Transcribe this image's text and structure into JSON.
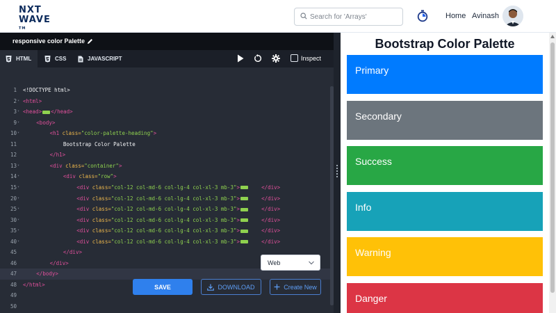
{
  "header": {
    "logo_line1": "NXT",
    "logo_line2": "WAVE",
    "logo_tm": "TM",
    "search_placeholder": "Search for 'Arrays'",
    "home_label": "Home",
    "user_name": "Avinash"
  },
  "project": {
    "title": "responsive color Palette"
  },
  "tabs": [
    {
      "label": "HTML",
      "active": true
    },
    {
      "label": "CSS",
      "active": false
    },
    {
      "label": "JAVASCRIPT",
      "active": false
    }
  ],
  "toolbar": {
    "inspect_label": "Inspect"
  },
  "editor": {
    "lines": [
      {
        "num": "1",
        "fold": false,
        "indent": 0,
        "parts": [
          [
            "tx",
            "<!DOCTYPE html>"
          ]
        ]
      },
      {
        "num": "2",
        "fold": true,
        "indent": 0,
        "parts": [
          [
            "tg",
            "<html>"
          ]
        ]
      },
      {
        "num": "3",
        "fold": true,
        "indent": 0,
        "parts": [
          [
            "tg",
            "<head>"
          ],
          [
            "pill",
            ""
          ],
          [
            "tg",
            "</head>"
          ]
        ]
      },
      {
        "num": "9",
        "fold": true,
        "indent": 1,
        "parts": [
          [
            "tg",
            "<body>"
          ]
        ]
      },
      {
        "num": "10",
        "fold": true,
        "indent": 2,
        "parts": [
          [
            "tg",
            "<h1 "
          ],
          [
            "at",
            "class="
          ],
          [
            "st",
            "\"color-palette-heading\""
          ],
          [
            "tg",
            ">"
          ]
        ]
      },
      {
        "num": "11",
        "fold": false,
        "indent": 3,
        "parts": [
          [
            "tx",
            "Bootstrap Color Palette"
          ]
        ]
      },
      {
        "num": "12",
        "fold": false,
        "indent": 2,
        "parts": [
          [
            "tg",
            "</h1>"
          ]
        ]
      },
      {
        "num": "13",
        "fold": true,
        "indent": 2,
        "parts": [
          [
            "tg",
            "<div "
          ],
          [
            "at",
            "class="
          ],
          [
            "st",
            "\"container\""
          ],
          [
            "tg",
            ">"
          ]
        ]
      },
      {
        "num": "14",
        "fold": true,
        "indent": 3,
        "parts": [
          [
            "tg",
            "<div "
          ],
          [
            "at",
            "class="
          ],
          [
            "st",
            "\"row\""
          ],
          [
            "tg",
            ">"
          ]
        ]
      },
      {
        "num": "15",
        "fold": true,
        "indent": 4,
        "parts": [
          [
            "tg",
            "<div "
          ],
          [
            "at",
            "class="
          ],
          [
            "st",
            "\"col-12 col-md-6 col-lg-4 col-xl-3 mb-3\""
          ],
          [
            "tg",
            ">"
          ],
          [
            "pill",
            ""
          ],
          [
            "tx",
            "    "
          ],
          [
            "tg",
            "</div>"
          ]
        ]
      },
      {
        "num": "20",
        "fold": true,
        "indent": 4,
        "parts": [
          [
            "tg",
            "<div "
          ],
          [
            "at",
            "class="
          ],
          [
            "st",
            "\"col-12 col-md-6 col-lg-4 col-xl-3 mb-3\""
          ],
          [
            "tg",
            ">"
          ],
          [
            "pill",
            ""
          ],
          [
            "tx",
            "    "
          ],
          [
            "tg",
            "</div>"
          ]
        ]
      },
      {
        "num": "25",
        "fold": true,
        "indent": 4,
        "parts": [
          [
            "tg",
            "<div "
          ],
          [
            "at",
            "class="
          ],
          [
            "st",
            "\"col-12 col-md-6 col-lg-4 col-xl-3 mb-3\""
          ],
          [
            "tg",
            ">"
          ],
          [
            "pill",
            ""
          ],
          [
            "tx",
            "    "
          ],
          [
            "tg",
            "</div>"
          ]
        ]
      },
      {
        "num": "30",
        "fold": true,
        "indent": 4,
        "parts": [
          [
            "tg",
            "<div "
          ],
          [
            "at",
            "class="
          ],
          [
            "st",
            "\"col-12 col-md-6 col-lg-4 col-xl-3 mb-3\""
          ],
          [
            "tg",
            ">"
          ],
          [
            "pill",
            ""
          ],
          [
            "tx",
            "    "
          ],
          [
            "tg",
            "</div>"
          ]
        ]
      },
      {
        "num": "35",
        "fold": true,
        "indent": 4,
        "parts": [
          [
            "tg",
            "<div "
          ],
          [
            "at",
            "class="
          ],
          [
            "st",
            "\"col-12 col-md-6 col-lg-4 col-xl-3 mb-3\""
          ],
          [
            "tg",
            ">"
          ],
          [
            "pill",
            ""
          ],
          [
            "tx",
            "    "
          ],
          [
            "tg",
            "</div>"
          ]
        ]
      },
      {
        "num": "40",
        "fold": true,
        "indent": 4,
        "parts": [
          [
            "tg",
            "<div "
          ],
          [
            "at",
            "class="
          ],
          [
            "st",
            "\"col-12 col-md-6 col-lg-4 col-xl-3 mb-3\""
          ],
          [
            "tg",
            ">"
          ],
          [
            "pill",
            ""
          ],
          [
            "tx",
            "    "
          ],
          [
            "tg",
            "</div>"
          ]
        ]
      },
      {
        "num": "45",
        "fold": false,
        "indent": 3,
        "parts": [
          [
            "tg",
            "</div>"
          ]
        ]
      },
      {
        "num": "46",
        "fold": false,
        "indent": 2,
        "parts": [
          [
            "tg",
            "</div>"
          ]
        ]
      },
      {
        "num": "47",
        "fold": false,
        "indent": 1,
        "current": true,
        "parts": [
          [
            "tg",
            "</body>"
          ]
        ]
      },
      {
        "num": "48",
        "fold": false,
        "indent": 0,
        "parts": [
          [
            "tg",
            "</html>"
          ]
        ]
      },
      {
        "num": "49",
        "fold": false,
        "indent": 0,
        "parts": []
      },
      {
        "num": "50",
        "fold": false,
        "indent": 0,
        "parts": []
      }
    ],
    "mode_select": "Web",
    "save_label": "SAVE",
    "download_label": "DOWNLOAD",
    "create_new_label": "Create New"
  },
  "preview": {
    "heading": "Bootstrap Color Palette",
    "swatches": [
      {
        "label": "Primary",
        "bg": "#007bff",
        "fg": "#ffffff"
      },
      {
        "label": "Secondary",
        "bg": "#6c757d",
        "fg": "#ffffff"
      },
      {
        "label": "Success",
        "bg": "#28a745",
        "fg": "#ffffff"
      },
      {
        "label": "Info",
        "bg": "#17a2b8",
        "fg": "#ffffff"
      },
      {
        "label": "Warning",
        "bg": "#ffc107",
        "fg": "#ffffff"
      },
      {
        "label": "Danger",
        "bg": "#dc3545",
        "fg": "#ffffff"
      }
    ]
  },
  "icons": {
    "search": "search-icon",
    "timer": "timer-icon",
    "edit": "pencil-icon",
    "run": "play-icon",
    "reset": "reset-icon",
    "settings": "gear-icon",
    "download": "download-icon",
    "add": "plus-icon",
    "chevron": "chevron-down-icon"
  }
}
